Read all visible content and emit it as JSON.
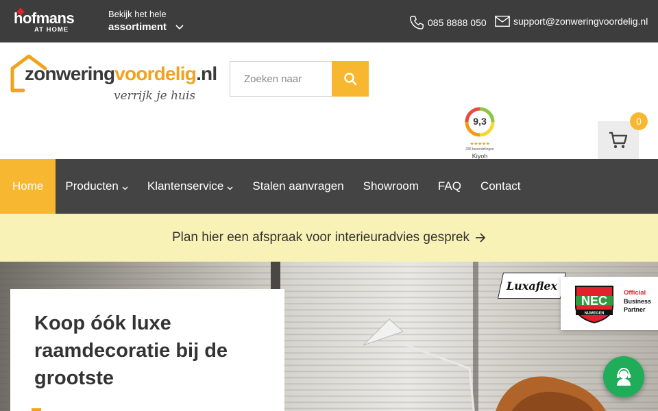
{
  "topbar": {
    "brand_name": "hofmans",
    "brand_sub": "AT HOME",
    "assortiment_line1": "Bekijk het hele",
    "assortiment_line2": "assortiment",
    "phone": "085 8888 050",
    "email": "support@zonweringvoordelig.nl"
  },
  "header": {
    "logo_part1": "zonwering",
    "logo_part2": "voordelig",
    "logo_part3": ".nl",
    "tagline": "verrijk je huis",
    "search_placeholder": "Zoeken naar",
    "rating_score": "9,3",
    "rating_stars": "★★★★★",
    "rating_reviews": "336 beoordelingen",
    "rating_provider": "Kiyoh",
    "cart_count": "0"
  },
  "nav": {
    "items": [
      {
        "label": "Home"
      },
      {
        "label": "Producten"
      },
      {
        "label": "Klantenservice"
      },
      {
        "label": "Stalen aanvragen"
      },
      {
        "label": "Showroom"
      },
      {
        "label": "FAQ"
      },
      {
        "label": "Contact"
      }
    ]
  },
  "banner": {
    "text": "Plan hier een afspraak voor interieuradvies gesprek"
  },
  "hero": {
    "headline": "Koop óók luxe raamdecoratie bij de grootste",
    "luxaflex": "Luxaflex",
    "nec_official": "Official",
    "nec_business": "Business",
    "nec_partner": "Partner",
    "nec_crest_text": "NEC",
    "nec_crest_city": "NIJMEGEN"
  },
  "colors": {
    "accent": "#f7b731",
    "topbar": "#3d3d3d",
    "nav": "#444444",
    "banner": "#f9f2b6",
    "chat": "#1fad5a"
  }
}
